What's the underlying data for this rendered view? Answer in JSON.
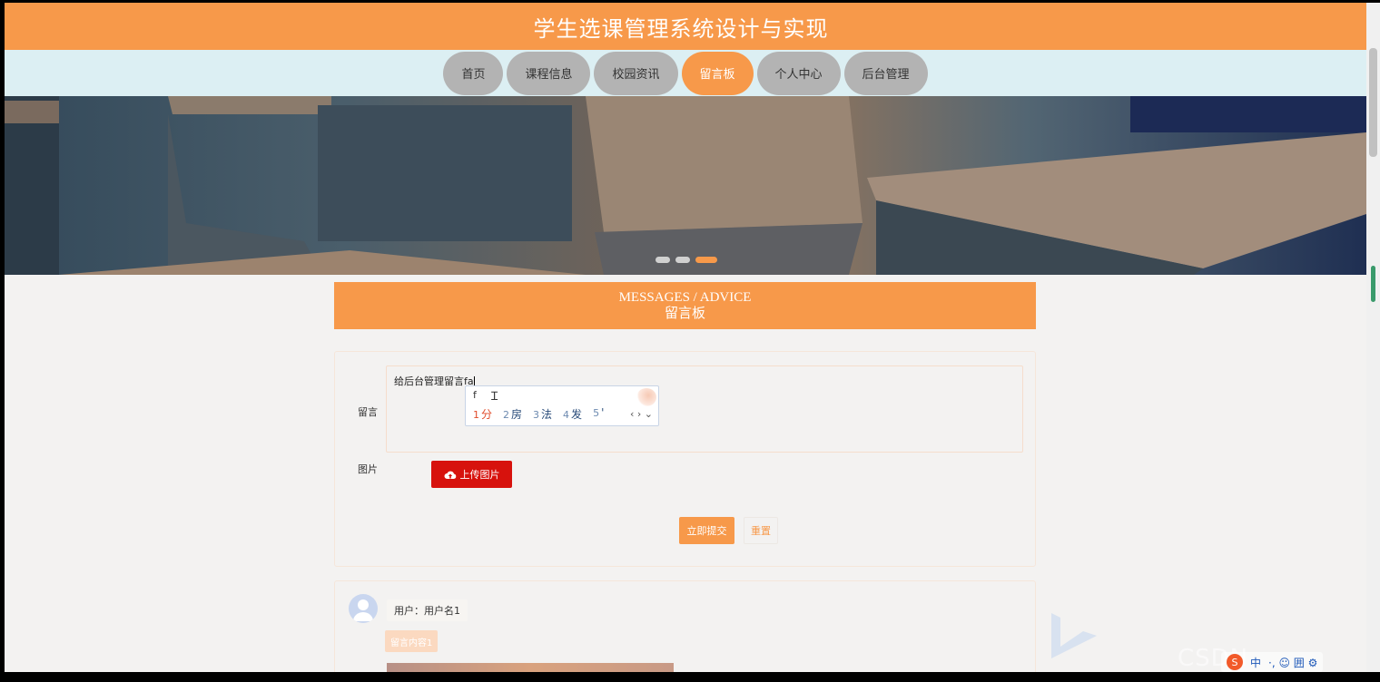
{
  "header": {
    "title": "学生选课管理系统设计与实现"
  },
  "nav": {
    "items": [
      {
        "label": "首页",
        "active": false
      },
      {
        "label": "课程信息",
        "active": false
      },
      {
        "label": "校园资讯",
        "active": false
      },
      {
        "label": "留言板",
        "active": true
      },
      {
        "label": "个人中心",
        "active": false
      },
      {
        "label": "后台管理",
        "active": false
      }
    ]
  },
  "banner": {
    "slides": 3,
    "active_slide": 3
  },
  "section": {
    "title_en": "MESSAGES / ADVICE",
    "title_cn": "留言板"
  },
  "form": {
    "message_label": "留言",
    "message_value": "给后台管理留言fa",
    "image_label": "图片",
    "upload_label": "上传图片",
    "submit_label": "立即提交",
    "reset_label": "重置"
  },
  "ime": {
    "pinyin": "f",
    "candidates": [
      {
        "n": "1",
        "text": "分"
      },
      {
        "n": "2",
        "text": "房"
      },
      {
        "n": "3",
        "text": "法"
      },
      {
        "n": "4",
        "text": "发"
      },
      {
        "n": "5",
        "text": "'"
      }
    ],
    "more": "‹ › ⌄"
  },
  "messages": [
    {
      "user_label": "用户：用户名1",
      "content": "留言内容1"
    }
  ],
  "watermark": "CSDN @CK3030",
  "tray": {
    "lang": "中",
    "items": "·, ☺ 囲 ⚙"
  },
  "colors": {
    "accent": "#f7994a",
    "nav_bg": "#dceff3",
    "upload_red": "#d7120d",
    "page_bg": "#f3f2f1"
  }
}
